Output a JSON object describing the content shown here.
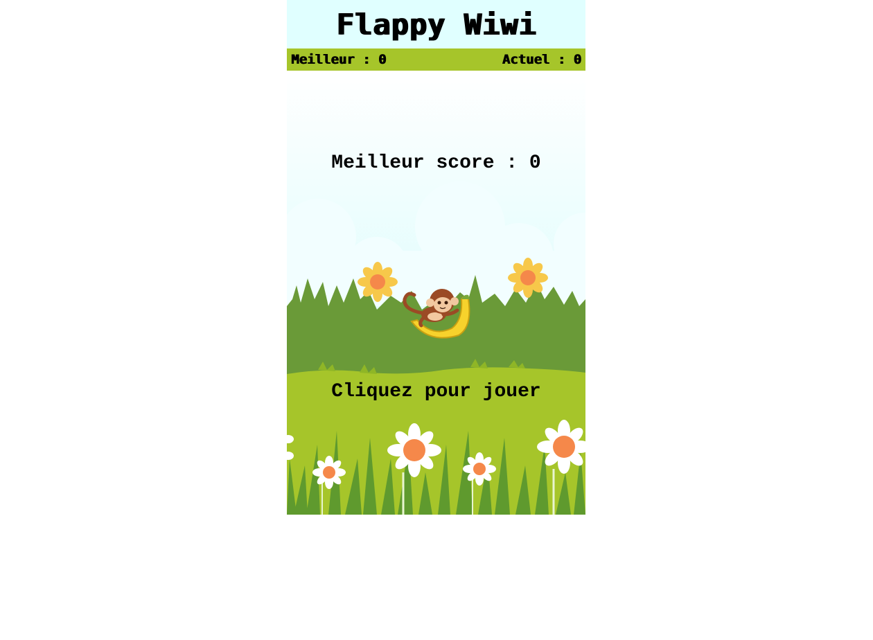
{
  "header": {
    "title": "Flappy Wiwi"
  },
  "scores": {
    "best_label": "Meilleur : 0",
    "current_label": "Actuel : 0"
  },
  "game": {
    "best_score_text": "Meilleur score : 0",
    "prompt_text": "Cliquez pour jouer",
    "player_icon": "monkey-on-banana-icon",
    "colors": {
      "sky": "#e0ffff",
      "score_bar": "#a6c52a",
      "grass_dark": "#6a9a38",
      "grass_light": "#a6c52a"
    }
  }
}
